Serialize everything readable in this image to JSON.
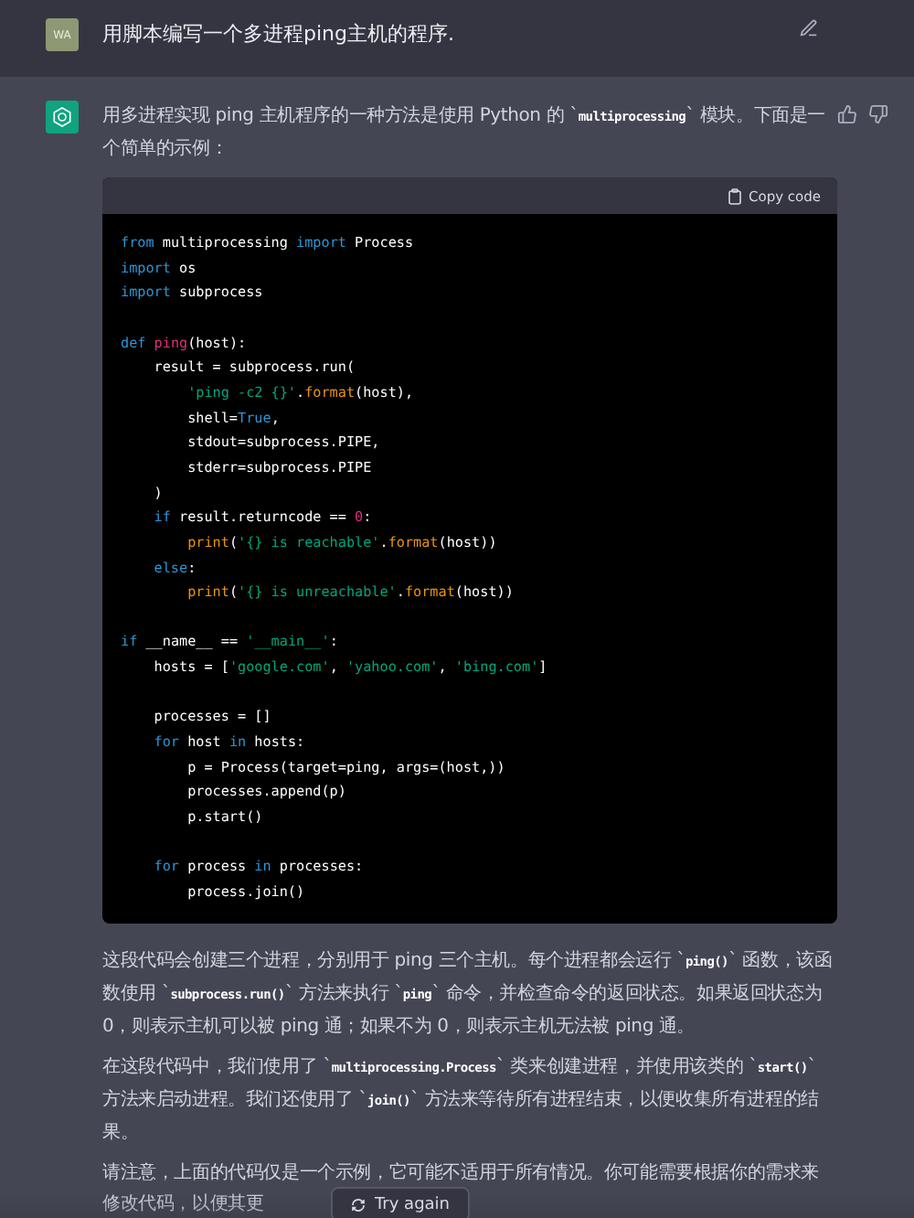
{
  "user_message": {
    "avatar": "WA",
    "text": "用脚本编写一个多进程ping主机的程序."
  },
  "assistant_message": {
    "intro": "用多进程实现 ping 主机程序的一种方法是使用 Python 的 `**multiprocessing**` 模块。下面是一个简单的示例：",
    "code_block": {
      "copy_label": "Copy code",
      "blocks": [
        [
          [
            {
              "kind": "keyword",
              "text": "from"
            },
            {
              "kind": "plain",
              "text": " multiprocessing "
            },
            {
              "kind": "keyword",
              "text": "import"
            },
            {
              "kind": "plain",
              "text": " Process"
            }
          ],
          [
            {
              "kind": "keyword",
              "text": "import"
            },
            {
              "kind": "plain",
              "text": " os"
            }
          ],
          [
            {
              "kind": "keyword",
              "text": "import"
            },
            {
              "kind": "plain",
              "text": " subprocess"
            }
          ]
        ],
        [
          [
            {
              "kind": "keyword",
              "text": "def "
            },
            {
              "kind": "name",
              "text": "ping"
            },
            {
              "kind": "plain",
              "text": "(host):"
            }
          ],
          [
            {
              "kind": "plain",
              "text": "    result = subprocess.run("
            }
          ],
          [
            {
              "kind": "string",
              "text": "        'ping -c2 {}'"
            },
            {
              "kind": "plain",
              "text": "."
            },
            {
              "kind": "call",
              "text": "format"
            },
            {
              "kind": "plain",
              "text": "(host),"
            }
          ],
          [
            {
              "kind": "plain",
              "text": "        shell="
            },
            {
              "kind": "keyword",
              "text": "True"
            },
            {
              "kind": "plain",
              "text": ","
            }
          ],
          [
            {
              "kind": "plain",
              "text": "        stdout=subprocess.PIPE,"
            }
          ],
          [
            {
              "kind": "plain",
              "text": "        stderr=subprocess.PIPE"
            }
          ],
          [
            {
              "kind": "plain",
              "text": "    )"
            }
          ],
          [
            {
              "kind": "keyword",
              "text": "    if"
            },
            {
              "kind": "plain",
              "text": " result.returncode == "
            },
            {
              "kind": "number",
              "text": "0"
            },
            {
              "kind": "plain",
              "text": ":"
            }
          ],
          [
            {
              "kind": "call",
              "text": "        print"
            },
            {
              "kind": "plain",
              "text": "("
            },
            {
              "kind": "string",
              "text": "'{} is reachable'"
            },
            {
              "kind": "plain",
              "text": "."
            },
            {
              "kind": "call",
              "text": "format"
            },
            {
              "kind": "plain",
              "text": "(host))"
            }
          ],
          [
            {
              "kind": "keyword",
              "text": "    else"
            },
            {
              "kind": "plain",
              "text": ":"
            }
          ],
          [
            {
              "kind": "call",
              "text": "        print"
            },
            {
              "kind": "plain",
              "text": "("
            },
            {
              "kind": "string",
              "text": "'{} is unreachable'"
            },
            {
              "kind": "plain",
              "text": "."
            },
            {
              "kind": "call",
              "text": "format"
            },
            {
              "kind": "plain",
              "text": "(host))"
            }
          ]
        ],
        [
          [
            {
              "kind": "keyword",
              "text": "if"
            },
            {
              "kind": "plain",
              "text": " __name__ == "
            },
            {
              "kind": "string",
              "text": "'__main__'"
            },
            {
              "kind": "plain",
              "text": ":"
            }
          ],
          [
            {
              "kind": "plain",
              "text": "    hosts = ["
            },
            {
              "kind": "string",
              "text": "'google.com'"
            },
            {
              "kind": "plain",
              "text": ", "
            },
            {
              "kind": "string",
              "text": "'yahoo.com'"
            },
            {
              "kind": "plain",
              "text": ", "
            },
            {
              "kind": "string",
              "text": "'bing.com'"
            },
            {
              "kind": "plain",
              "text": "]"
            }
          ]
        ],
        [
          [
            {
              "kind": "plain",
              "text": "    processes = []"
            }
          ],
          [
            {
              "kind": "keyword",
              "text": "    for"
            },
            {
              "kind": "plain",
              "text": " host "
            },
            {
              "kind": "keyword",
              "text": "in"
            },
            {
              "kind": "plain",
              "text": " hosts:"
            }
          ],
          [
            {
              "kind": "plain",
              "text": "        p = Process(target=ping, args=(host,))"
            }
          ],
          [
            {
              "kind": "plain",
              "text": "        processes.append(p)"
            }
          ],
          [
            {
              "kind": "plain",
              "text": "        p.start()"
            }
          ]
        ],
        [
          [
            {
              "kind": "keyword",
              "text": "    for"
            },
            {
              "kind": "plain",
              "text": " process "
            },
            {
              "kind": "keyword",
              "text": "in"
            },
            {
              "kind": "plain",
              "text": " processes:"
            }
          ],
          [
            {
              "kind": "plain",
              "text": "        process.join()"
            }
          ]
        ]
      ]
    },
    "paragraphs": [
      "这段代码会创建三个进程，分别用于 ping 三个主机。每个进程都会运行 `**ping()**` 函数，该函数使用 `**subprocess.run()**` 方法来执行 `**ping**` 命令，并检查命令的返回状态。如果返回状态为 0，则表示主机可以被 ping 通；如果不为 0，则表示主机无法被 ping 通。",
      "在这段代码中，我们使用了 `**multiprocessing.Process**` 类来创建进程，并使用该类的 `**start()**` 方法来启动进程。我们还使用了 `**join()**` 方法来等待所有进程结束，以便收集所有进程的结果。"
    ],
    "cut_paragraph_lines": [
      "请注意，上面的代码仅是一个示例，它可能不适用于所有情况。你可能需要根据你的需求来",
      "修改代码，以便其更"
    ]
  },
  "try_again_button": "Try again"
}
